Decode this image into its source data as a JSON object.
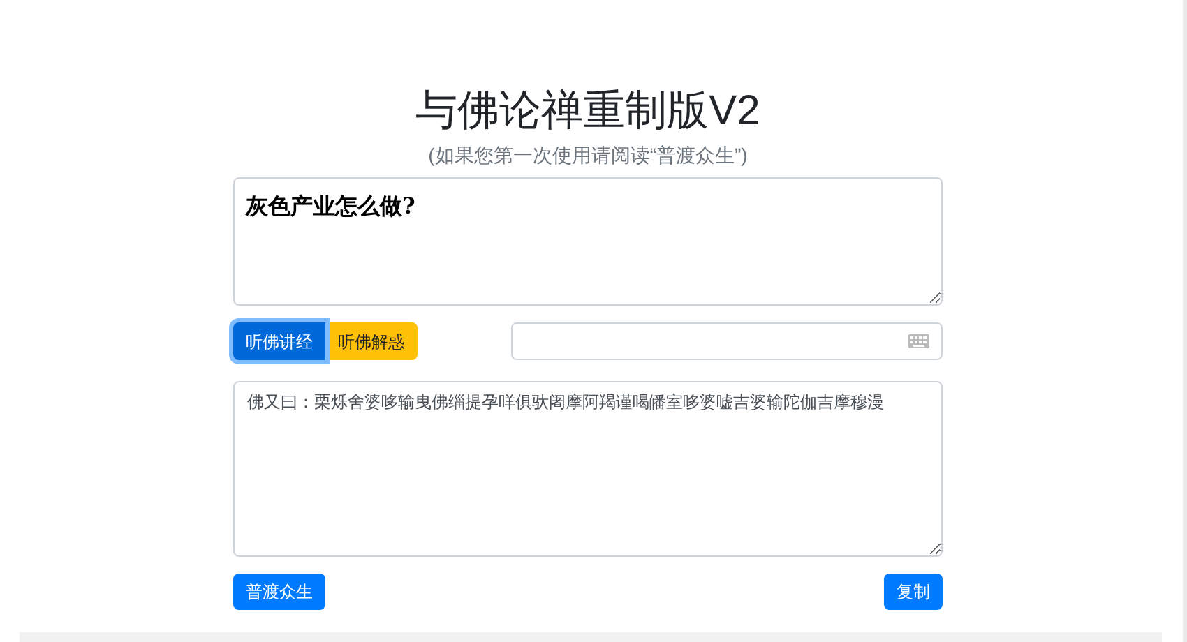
{
  "title": "与佛论禅重制版V2",
  "subtitle": "(如果您第一次使用请阅读“普渡众生”)",
  "input_text": "灰色产业怎么做?",
  "mode_buttons": [
    {
      "label": "听佛讲经",
      "selected": true,
      "color": "#0069d9"
    },
    {
      "label": "听佛解惑",
      "selected": false,
      "color": "#ffc107"
    }
  ],
  "output_text": "佛又曰：栗烁舍婆哆输曳佛缁提孕咩俱驮阇摩阿羯谨喝皤室哆婆嘘吉婆输陀伽吉摩穆漫",
  "bottom_buttons": [
    {
      "label": "普渡众生"
    },
    {
      "label": "复制"
    }
  ]
}
